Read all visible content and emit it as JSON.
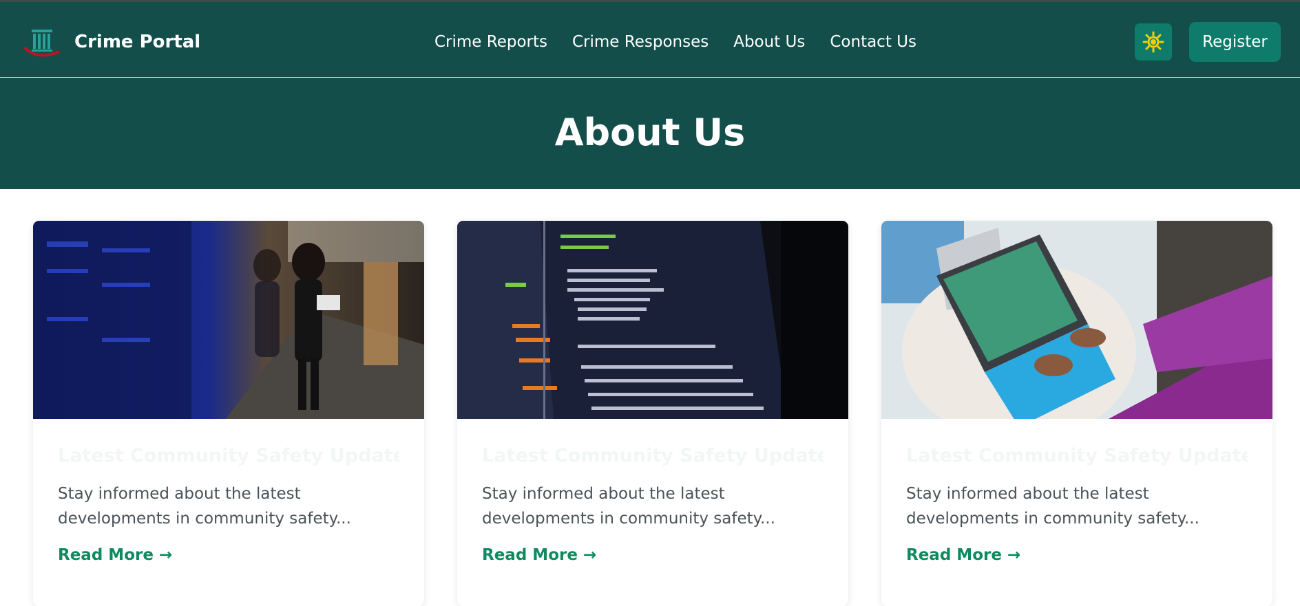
{
  "header": {
    "brand_name": "Crime Portal",
    "nav": [
      {
        "label": "Crime Reports"
      },
      {
        "label": "Crime Responses"
      },
      {
        "label": "About Us"
      },
      {
        "label": "Contact Us"
      }
    ],
    "theme_icon": "sun-icon",
    "register_label": "Register"
  },
  "hero": {
    "title": "About Us"
  },
  "cards": [
    {
      "image_icon": "server-room-photo",
      "title": "Latest Community Safety Updates",
      "text": "Stay informed about the latest developments in community safety...",
      "link": "Read More →"
    },
    {
      "image_icon": "code-screen-photo",
      "title": "Latest Community Safety Updates",
      "text": "Stay informed about the latest developments in community safety...",
      "link": "Read More →"
    },
    {
      "image_icon": "laptop-user-photo",
      "title": "Latest Community Safety Updates",
      "text": "Stay informed about the latest developments in community safety...",
      "link": "Read More →"
    }
  ],
  "colors": {
    "primary_dark": "#134e4a",
    "button": "#0e7b6b",
    "link": "#0f8a5f",
    "sun": "#f5d000"
  }
}
